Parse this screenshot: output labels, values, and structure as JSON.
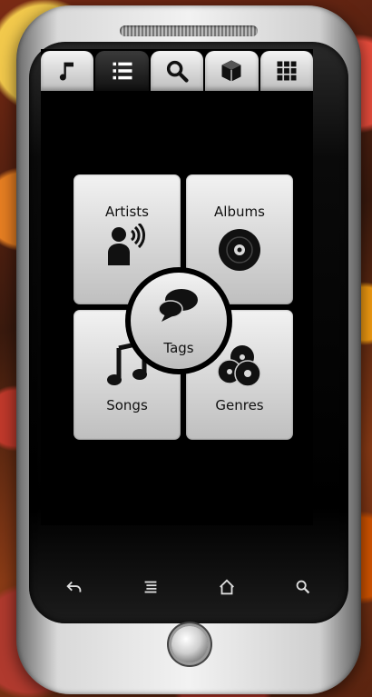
{
  "tabs": [
    {
      "icon": "music-note-icon",
      "active": false
    },
    {
      "icon": "list-icon",
      "active": true
    },
    {
      "icon": "search-icon",
      "active": false
    },
    {
      "icon": "box-icon",
      "active": false
    },
    {
      "icon": "grid-icon",
      "active": false
    }
  ],
  "tiles": {
    "artists": {
      "label": "Artists",
      "icon": "speaking-person-icon"
    },
    "albums": {
      "label": "Albums",
      "icon": "disc-icon"
    },
    "songs": {
      "label": "Songs",
      "icon": "music-notes-icon"
    },
    "genres": {
      "label": "Genres",
      "icon": "discs-stack-icon"
    }
  },
  "center": {
    "label": "Tags",
    "icon": "chat-bubbles-icon"
  },
  "navbar": [
    {
      "icon": "back-icon"
    },
    {
      "icon": "menu-icon"
    },
    {
      "icon": "home-icon"
    },
    {
      "icon": "search-icon"
    }
  ],
  "colors": {
    "tile_top": "#f2f2f2",
    "tile_bottom": "#bfbfbf",
    "screen_bg": "#000000"
  }
}
